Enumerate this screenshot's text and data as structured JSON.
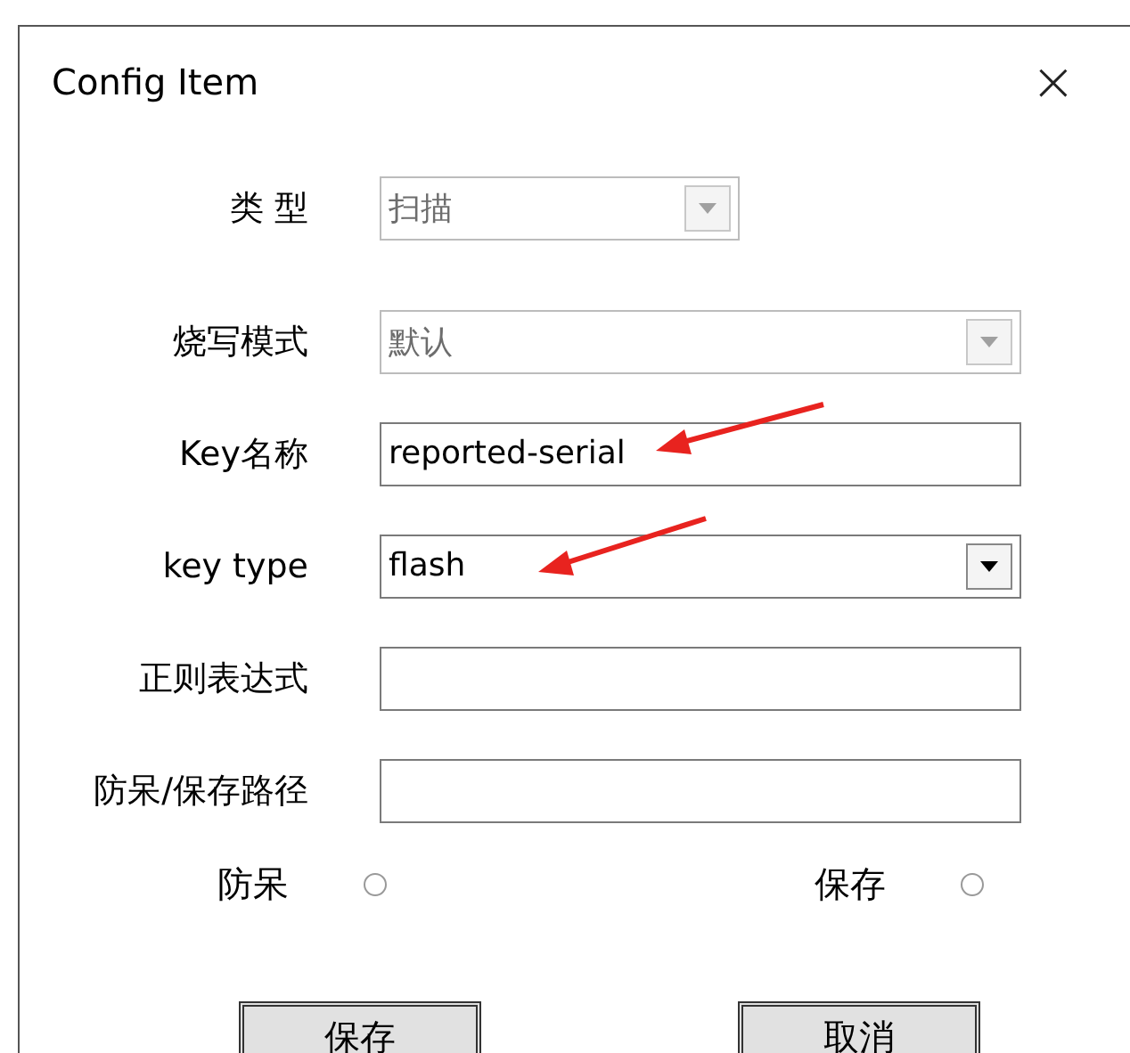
{
  "window": {
    "title": "Config Item",
    "close": "×"
  },
  "fields": [
    {
      "label": "类 型",
      "kind": "short-combo",
      "value": "扫描",
      "disabled": true
    },
    {
      "label": "烧写模式",
      "kind": "combo",
      "value": "默认",
      "disabled": true
    },
    {
      "label": "Key名称",
      "kind": "text",
      "value": "reported-serial",
      "disabled": false
    },
    {
      "label": "key type",
      "kind": "combo",
      "value": "flash",
      "disabled": false
    },
    {
      "label": "正则表达式",
      "kind": "text",
      "disabled": false
    },
    {
      "label": "防呆/保存路径",
      "kind": "text",
      "disabled": false
    }
  ],
  "radios": [
    {
      "label": "防呆",
      "selected": false
    },
    {
      "label": "保存",
      "selected": false
    }
  ],
  "buttons": [
    "保存",
    "取消"
  ]
}
